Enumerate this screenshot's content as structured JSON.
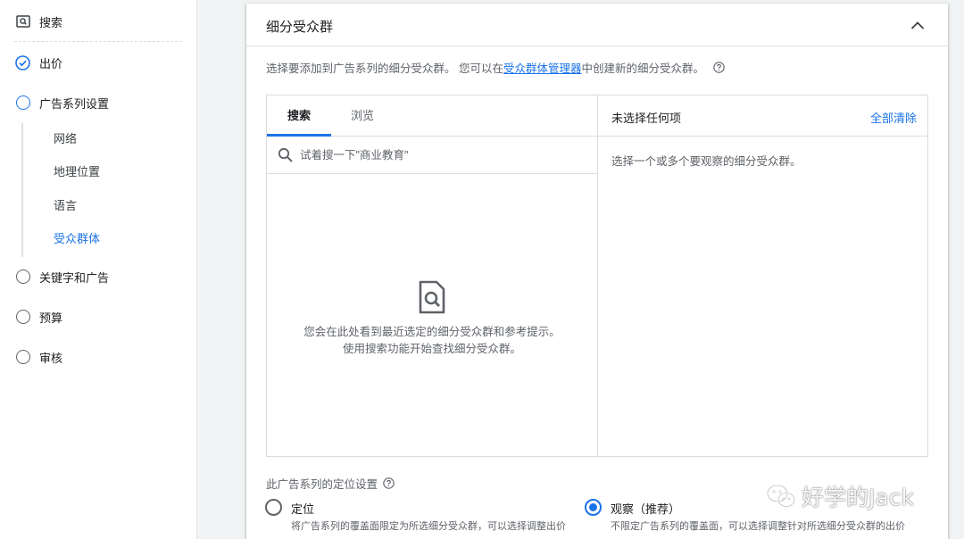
{
  "sidebar": {
    "items": [
      {
        "label": "搜索",
        "icon": "search-box-icon"
      },
      {
        "label": "出价",
        "icon": "check-circle-icon"
      },
      {
        "label": "广告系列设置",
        "icon": "circle-icon"
      },
      {
        "label": "关键字和广告",
        "icon": "circle-icon"
      },
      {
        "label": "预算",
        "icon": "circle-icon"
      },
      {
        "label": "审核",
        "icon": "circle-icon"
      }
    ],
    "subitems": [
      {
        "label": "网络"
      },
      {
        "label": "地理位置"
      },
      {
        "label": "语言"
      },
      {
        "label": "受众群体",
        "active": true
      }
    ]
  },
  "card": {
    "title": "细分受众群",
    "description_before": "选择要添加到广告系列的细分受众群。 您可以在",
    "description_link": "受众群体管理器",
    "description_after": "中创建新的细分受众群。",
    "tabs": [
      {
        "label": "搜索",
        "active": true
      },
      {
        "label": "浏览"
      }
    ],
    "search": {
      "placeholder": "试着搜一下\"商业教育\"",
      "value": ""
    },
    "empty_state": {
      "line1": "您会在此处看到最近选定的细分受众群和参考提示。",
      "line2": "使用搜索功能开始查找细分受众群。"
    },
    "selected": {
      "title": "未选择任何项",
      "clear_all": "全部清除",
      "hint": "选择一个或多个要观察的细分受众群。"
    },
    "targeting": {
      "label": "此广告系列的定位设置",
      "options": [
        {
          "title": "定位",
          "desc": "将广告系列的覆盖面限定为所选细分受众群，可以选择调整出价",
          "checked": false
        },
        {
          "title": "观察（推荐）",
          "desc": "不限定广告系列的覆盖面，可以选择调整针对所选细分受众群的出价",
          "checked": true
        }
      ]
    }
  },
  "watermark": {
    "text": "好学的Jack",
    "icon": "wechat-icon"
  },
  "colors": {
    "accent": "#1a73e8",
    "text": "#202124",
    "muted": "#5f6368",
    "border": "#dadce0"
  }
}
